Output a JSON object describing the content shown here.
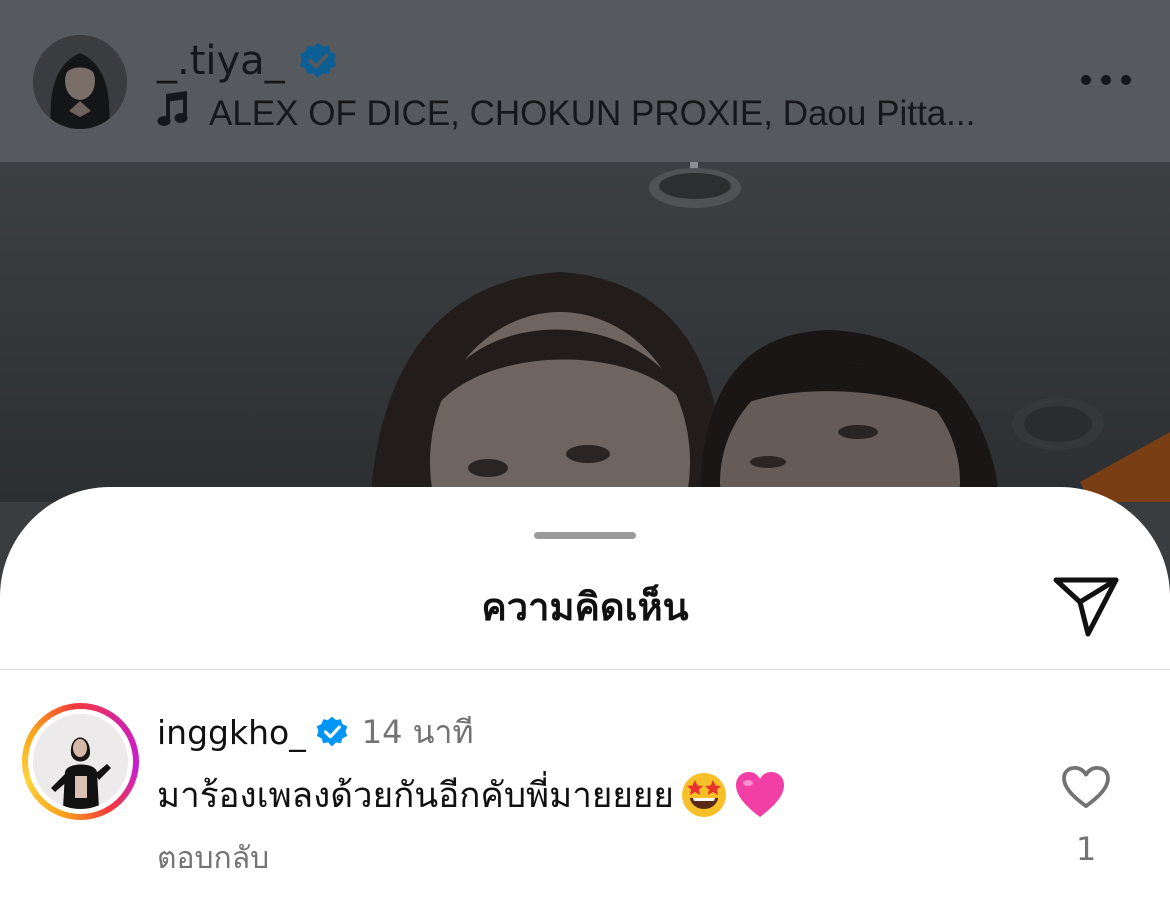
{
  "post": {
    "username": "_.tiya_",
    "music": "ALEX OF DICE, CHOKUN PROXIE, Daou Pitta...",
    "icons": {
      "verified": "verified-badge-icon",
      "music": "music-note-icon",
      "more": "more-options-icon"
    }
  },
  "comments_sheet": {
    "title": "ความคิดเห็น",
    "share_icon": "send-icon",
    "comments": [
      {
        "username": "inggkho_",
        "verified": true,
        "time": "14 นาที",
        "text": "มาร้องเพลงด้วยกันอีกคับพี่มายยยย",
        "emojis": [
          "star-struck-emoji",
          "pink-heart-emoji"
        ],
        "reply_label": "ตอบกลับ",
        "like_count": "1"
      }
    ]
  },
  "colors": {
    "verified_blue": "#0095f6",
    "verified_blue_dimmed": "#0d5e94",
    "secondary_text": "#737373",
    "overlay": "#56595d"
  }
}
